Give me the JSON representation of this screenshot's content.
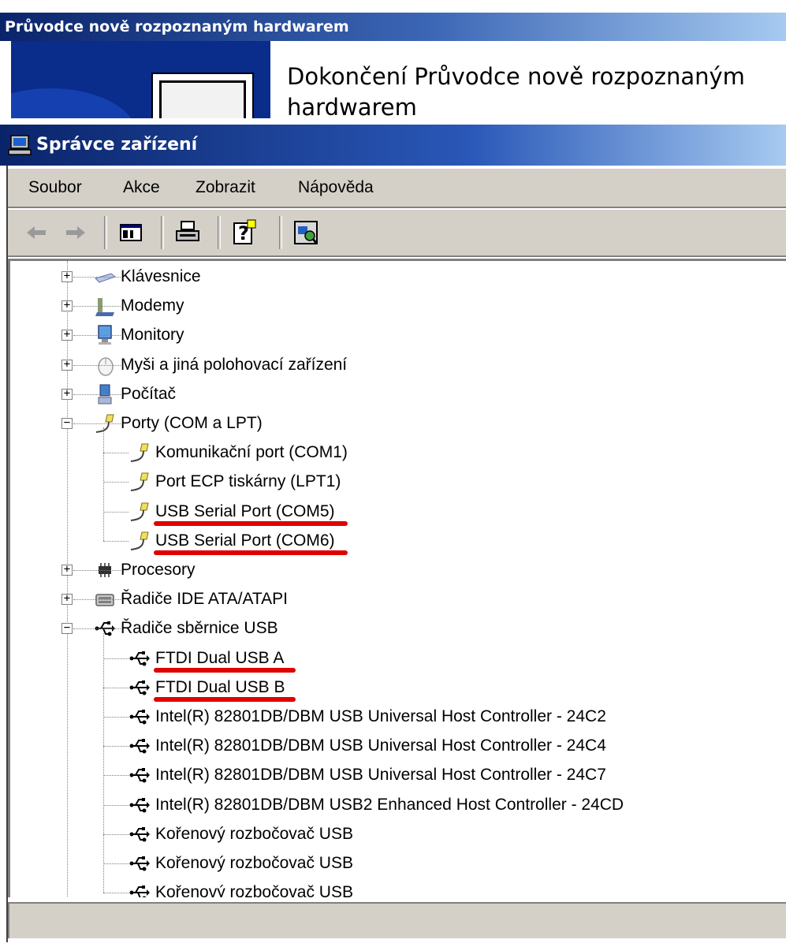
{
  "wizard": {
    "title": "Průvodce nově rozpoznaným hardwarem",
    "heading": "Dokončení Průvodce nově rozpoznaným hardwarem"
  },
  "device_manager": {
    "title": "Správce zařízení",
    "menu": [
      "Soubor",
      "Akce",
      "Zobrazit",
      "Nápověda"
    ],
    "toolbar": [
      {
        "name": "back-icon",
        "glyph": "⇦"
      },
      {
        "name": "forward-icon",
        "glyph": "⇨"
      },
      {
        "name": "show-hide-tree-icon",
        "glyph": ""
      },
      {
        "name": "print-icon",
        "glyph": ""
      },
      {
        "name": "help-icon",
        "glyph": "?"
      },
      {
        "name": "scan-hardware-icon",
        "glyph": ""
      }
    ],
    "tree": {
      "categories": [
        {
          "label": "Klávesnice",
          "icon": "keyboard-icon",
          "expanded": false
        },
        {
          "label": "Modemy",
          "icon": "modem-icon",
          "expanded": false
        },
        {
          "label": "Monitory",
          "icon": "monitor-icon",
          "expanded": false
        },
        {
          "label": "Myši a jiná polohovací zařízení",
          "icon": "mouse-icon",
          "expanded": false
        },
        {
          "label": "Počítač",
          "icon": "computer-icon",
          "expanded": false
        },
        {
          "label": "Porty (COM a LPT)",
          "icon": "port-icon",
          "expanded": true,
          "children": [
            {
              "label": "Komunikační port (COM1)",
              "icon": "port-icon",
              "highlighted": false
            },
            {
              "label": "Port ECP tiskárny (LPT1)",
              "icon": "port-icon",
              "highlighted": false
            },
            {
              "label": "USB Serial Port (COM5)",
              "icon": "port-icon",
              "highlighted": true
            },
            {
              "label": "USB Serial Port (COM6)",
              "icon": "port-icon",
              "highlighted": true
            }
          ]
        },
        {
          "label": "Procesory",
          "icon": "processor-icon",
          "expanded": false
        },
        {
          "label": "Řadiče IDE ATA/ATAPI",
          "icon": "ide-controller-icon",
          "expanded": false
        },
        {
          "label": "Řadiče sběrnice USB",
          "icon": "usb-icon",
          "expanded": true,
          "children": [
            {
              "label": "FTDI Dual USB A",
              "icon": "usb-icon",
              "highlighted": true
            },
            {
              "label": "FTDI Dual USB B",
              "icon": "usb-icon",
              "highlighted": true
            },
            {
              "label": "Intel(R) 82801DB/DBM USB Universal Host Controller - 24C2",
              "icon": "usb-icon",
              "highlighted": false
            },
            {
              "label": "Intel(R) 82801DB/DBM USB Universal Host Controller - 24C4",
              "icon": "usb-icon",
              "highlighted": false
            },
            {
              "label": "Intel(R) 82801DB/DBM USB Universal Host Controller - 24C7",
              "icon": "usb-icon",
              "highlighted": false
            },
            {
              "label": "Intel(R) 82801DB/DBM USB2 Enhanced Host Controller - 24CD",
              "icon": "usb-icon",
              "highlighted": false
            },
            {
              "label": "Kořenový rozbočovač USB",
              "icon": "usb-icon",
              "highlighted": false
            },
            {
              "label": "Kořenový rozbočovač USB",
              "icon": "usb-icon",
              "highlighted": false
            },
            {
              "label": "Kořenový rozbočovač USB",
              "icon": "usb-icon",
              "highlighted": false
            }
          ]
        }
      ]
    },
    "status_text": ""
  },
  "colors": {
    "titlebar_start": "#0a246a",
    "titlebar_end": "#a6caf0",
    "window_face": "#d4d0c8",
    "highlight_underline": "#e00000"
  }
}
